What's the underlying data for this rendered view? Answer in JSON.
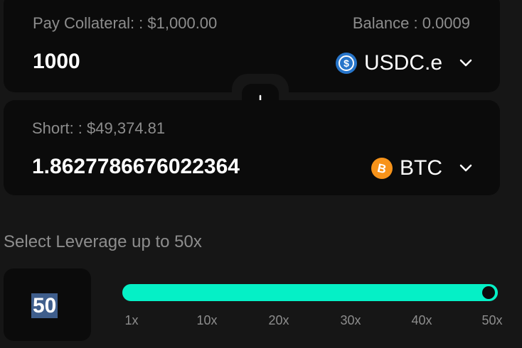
{
  "pay": {
    "label": "Pay Collateral: : $1,000.00",
    "balance": "Balance : 0.0009",
    "amount": "1000",
    "token": "USDC.e",
    "token_icon": "usdc-icon",
    "token_color": "#2775ca"
  },
  "swap": {
    "icon": "arrow-down-icon"
  },
  "short": {
    "label": "Short: : $49,374.81",
    "amount": "1.8627786676022364",
    "token": "BTC",
    "token_icon": "bitcoin-icon",
    "token_color": "#f7931a"
  },
  "leverage": {
    "label": "Select Leverage up to 50x",
    "value": "50",
    "slider_fraction": 1.0,
    "ticks": [
      "1x",
      "10x",
      "20x",
      "30x",
      "40x",
      "50x"
    ],
    "accent_color": "#05f0c6"
  }
}
